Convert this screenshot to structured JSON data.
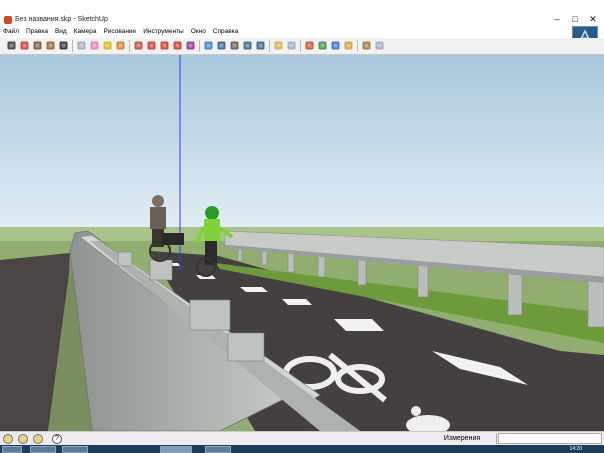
{
  "window": {
    "title": "Без названия.skp - SketchUp",
    "controls": [
      "–",
      "□",
      "✕"
    ]
  },
  "menu": [
    "Файл",
    "Правка",
    "Вид",
    "Камера",
    "Рисование",
    "Инструменты",
    "Окно",
    "Справка"
  ],
  "toolbar": {
    "tools": [
      {
        "name": "select-tool-icon",
        "color": "#333333"
      },
      {
        "name": "pencil-tool-icon",
        "color": "#c0392b"
      },
      {
        "name": "rectangle-tool-icon",
        "color": "#7a4a2a"
      },
      {
        "name": "circle-tool-icon",
        "color": "#8b5a2b"
      },
      {
        "name": "arc-tool-icon",
        "color": "#222222"
      },
      {
        "name": "make-component-icon",
        "color": "#9aa7b8"
      },
      {
        "name": "eraser-tool-icon",
        "color": "#e07aa8"
      },
      {
        "name": "tape-measure-icon",
        "color": "#d8b400"
      },
      {
        "name": "paint-bucket-icon",
        "color": "#d07a20"
      },
      {
        "name": "push-pull-icon",
        "color": "#b8422a"
      },
      {
        "name": "move-tool-icon",
        "color": "#cc2a2a"
      },
      {
        "name": "rotate-tool-icon",
        "color": "#cc2a2a"
      },
      {
        "name": "follow-me-icon",
        "color": "#cc2a2a"
      },
      {
        "name": "scale-tool-icon",
        "color": "#8a2a8a"
      },
      {
        "name": "orbit-tool-icon",
        "color": "#2a7acc"
      },
      {
        "name": "pan-tool-icon",
        "color": "#2a5a8a"
      },
      {
        "name": "zoom-tool-icon",
        "color": "#555555"
      },
      {
        "name": "zoom-window-icon",
        "color": "#2a5a8a"
      },
      {
        "name": "zoom-extents-icon",
        "color": "#2a5a8a"
      },
      {
        "name": "get-models-icon",
        "color": "#d0b040"
      },
      {
        "name": "share-model-icon",
        "color": "#9aa7b8"
      },
      {
        "name": "add-location-icon",
        "color": "#c04a2a"
      },
      {
        "name": "toggle-terrain-icon",
        "color": "#3a8a3a"
      },
      {
        "name": "google-earth-icon",
        "color": "#2a6ac0"
      },
      {
        "name": "warehouse-icon",
        "color": "#d0a030"
      },
      {
        "name": "extension-icon",
        "color": "#a07030"
      },
      {
        "name": "layout-icon",
        "color": "#9aa7b8"
      }
    ]
  },
  "status": {
    "measure_label": "Измерения",
    "measure_value": "",
    "help_glyph": "?"
  },
  "taskbar": {
    "time": "14:20"
  }
}
